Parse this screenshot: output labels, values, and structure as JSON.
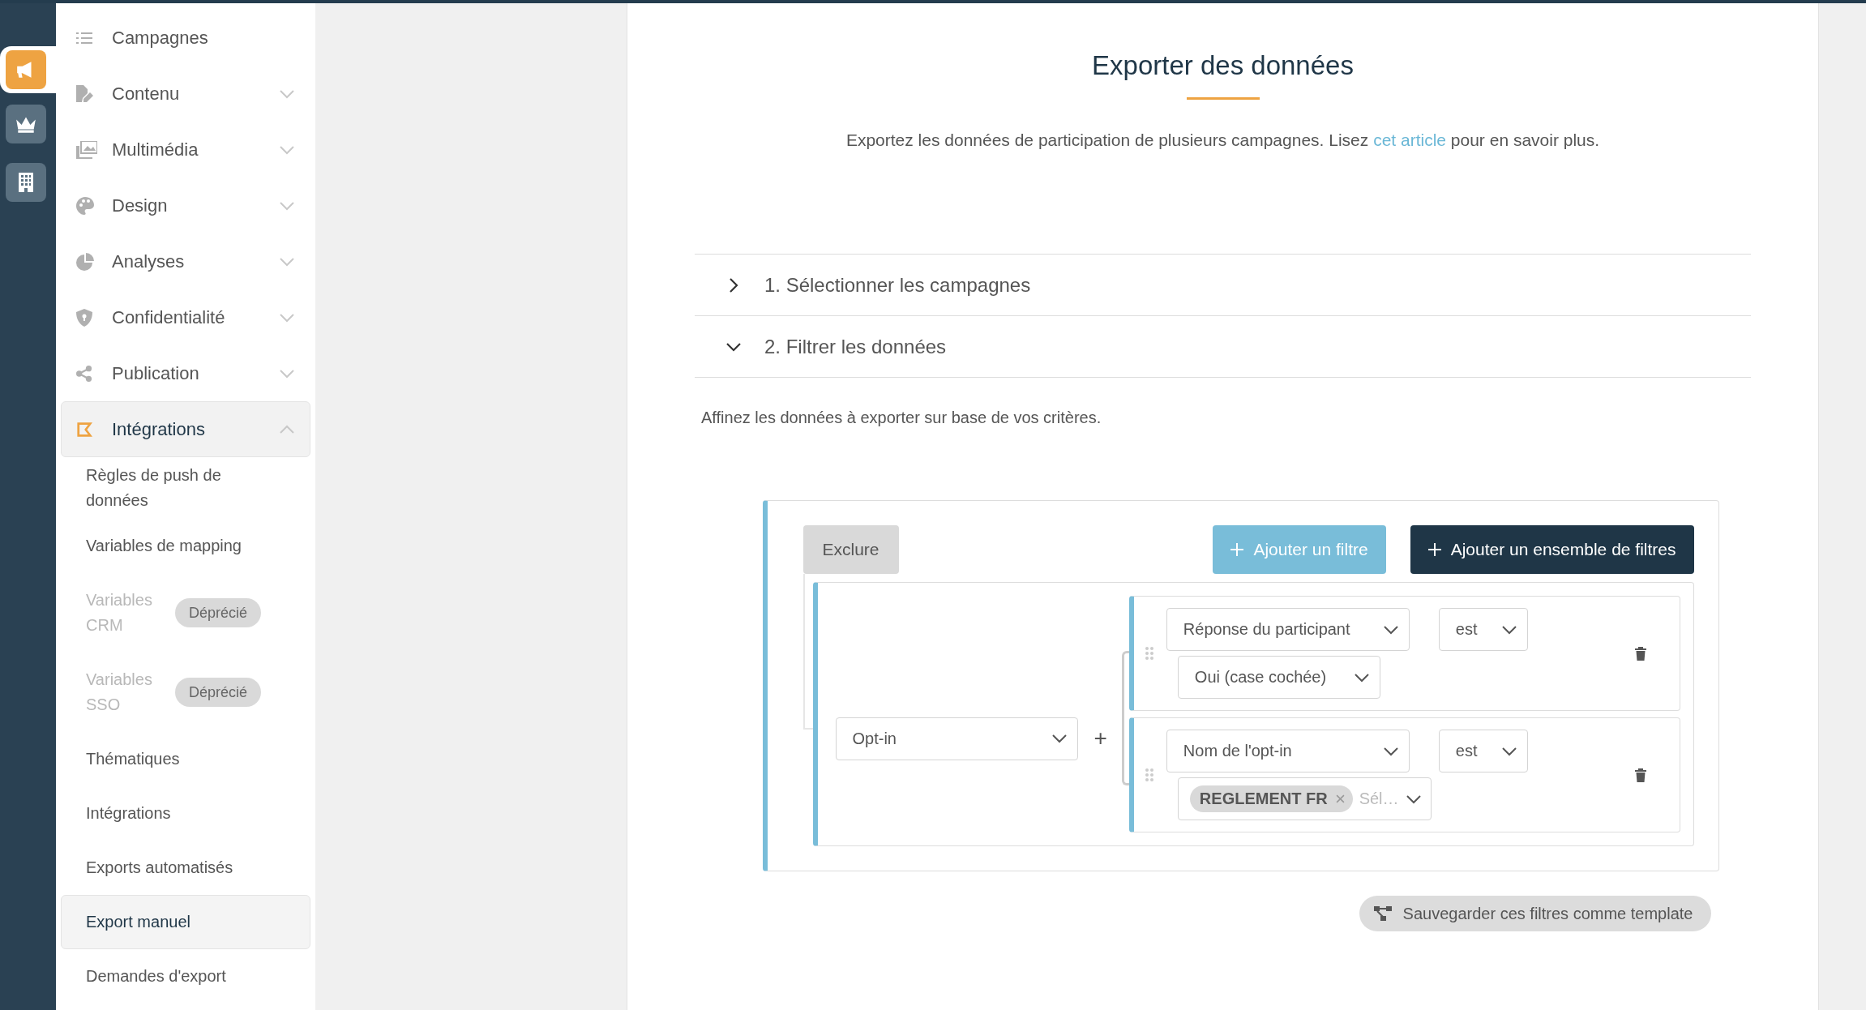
{
  "rail": [
    {
      "kind": "megaphone",
      "selected": true
    },
    {
      "kind": "crown",
      "selected": false
    },
    {
      "kind": "building",
      "selected": false
    }
  ],
  "sidebar": {
    "items": [
      {
        "label": "Campagnes",
        "kind": "list",
        "expandable": false,
        "selected": false
      },
      {
        "label": "Contenu",
        "kind": "file-pen",
        "expandable": true,
        "expanded": false,
        "selected": false
      },
      {
        "label": "Multimédia",
        "kind": "images",
        "expandable": true,
        "expanded": false,
        "selected": false
      },
      {
        "label": "Design",
        "kind": "palette",
        "expandable": true,
        "expanded": false,
        "selected": false
      },
      {
        "label": "Analyses",
        "kind": "pie",
        "expandable": true,
        "expanded": false,
        "selected": false
      },
      {
        "label": "Confidentialité",
        "kind": "shield",
        "expandable": true,
        "expanded": false,
        "selected": false
      },
      {
        "label": "Publication",
        "kind": "share",
        "expandable": true,
        "expanded": false,
        "selected": false
      },
      {
        "label": "Intégrations",
        "kind": "vector",
        "expandable": true,
        "expanded": true,
        "selected": true,
        "children": [
          {
            "label": "Règles de push de données",
            "selected": false,
            "disabled": false
          },
          {
            "label": "Variables de mapping",
            "selected": false,
            "disabled": false
          },
          {
            "label": "Variables CRM",
            "selected": false,
            "disabled": true,
            "badge": "Déprécié"
          },
          {
            "label": "Variables SSO",
            "selected": false,
            "disabled": true,
            "badge": "Déprécié"
          },
          {
            "label": "Thématiques",
            "selected": false,
            "disabled": false
          },
          {
            "label": "Intégrations",
            "selected": false,
            "disabled": false
          },
          {
            "label": "Exports automatisés",
            "selected": false,
            "disabled": false
          },
          {
            "label": "Export manuel",
            "selected": true,
            "disabled": false
          },
          {
            "label": "Demandes d'export",
            "selected": false,
            "disabled": false
          }
        ]
      }
    ]
  },
  "page": {
    "title": "Exporter des données",
    "intro_before": "Exportez les données de participation de plusieurs campagnes. Lisez ",
    "intro_link": "cet article",
    "intro_after": " pour en savoir plus.",
    "sections": [
      {
        "label": "1. Sélectionner les campagnes",
        "expanded": false
      },
      {
        "label": "2. Filtrer les données",
        "expanded": true
      }
    ],
    "hint": "Affinez les données à exporter sur base de vos critères.",
    "filter_builder": {
      "exclude_button": "Exclure",
      "add_filter_button": "Ajouter un filtre",
      "add_set_button": "Ajouter un ensemble de filtres",
      "group": {
        "field": "Opt-in",
        "join": "+",
        "filters": [
          {
            "field": "Réponse du participant",
            "operator": "est",
            "value": {
              "kind": "select",
              "text": "Oui (case cochée)"
            }
          },
          {
            "field": "Nom de l'opt-in",
            "operator": "est",
            "value": {
              "kind": "tags",
              "tags": [
                "REGLEMENT FR"
              ],
              "placeholder": "Sél…"
            }
          }
        ]
      }
    },
    "save_template_button": "Sauvegarder ces filtres comme template"
  }
}
